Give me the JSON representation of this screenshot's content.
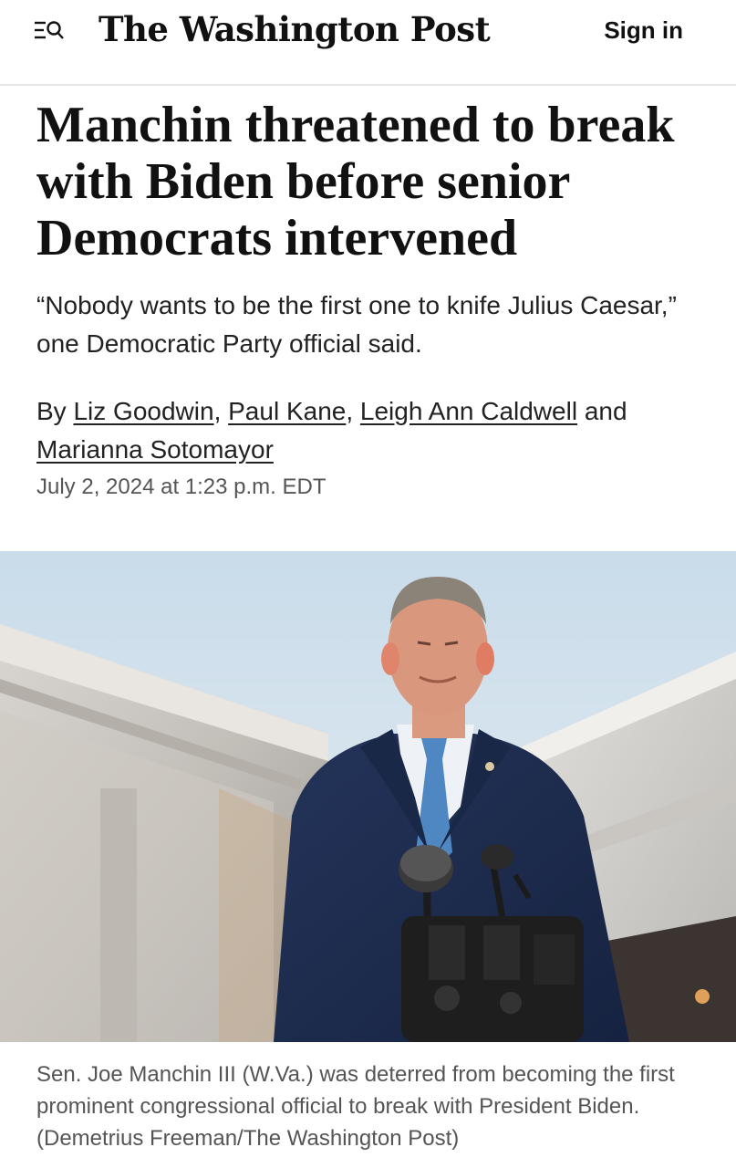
{
  "header": {
    "logo_text": "The Washington Post",
    "signin_label": "Sign in",
    "menu_icon": "menu-search-icon"
  },
  "article": {
    "headline": "Manchin threatened to break with Biden before senior Democrats intervened",
    "dek": "“Nobody wants to be the first one to knife Julius Caesar,” one Democratic Party official said.",
    "byline_prefix": "By",
    "authors": [
      "Liz Goodwin",
      "Paul Kane",
      "Leigh Ann Caldwell",
      "Marianna Sotomayor"
    ],
    "sep1": ", ",
    "sep2": ", ",
    "sep3": " and ",
    "dateline": "July 2, 2024 at 1:23 p.m. EDT"
  },
  "photo": {
    "caption": "Sen. Joe Manchin III (W.Va.) was deterred from becoming the first prominent congressional official to break with President Biden. (Demetrius Freeman/The Washington Post)"
  },
  "colors": {
    "text": "#111111",
    "muted": "#555555",
    "divider": "#e6e6e6",
    "sky": "#cfe1ee",
    "suit": "#1f2e4d",
    "tie": "#4f87c3"
  }
}
